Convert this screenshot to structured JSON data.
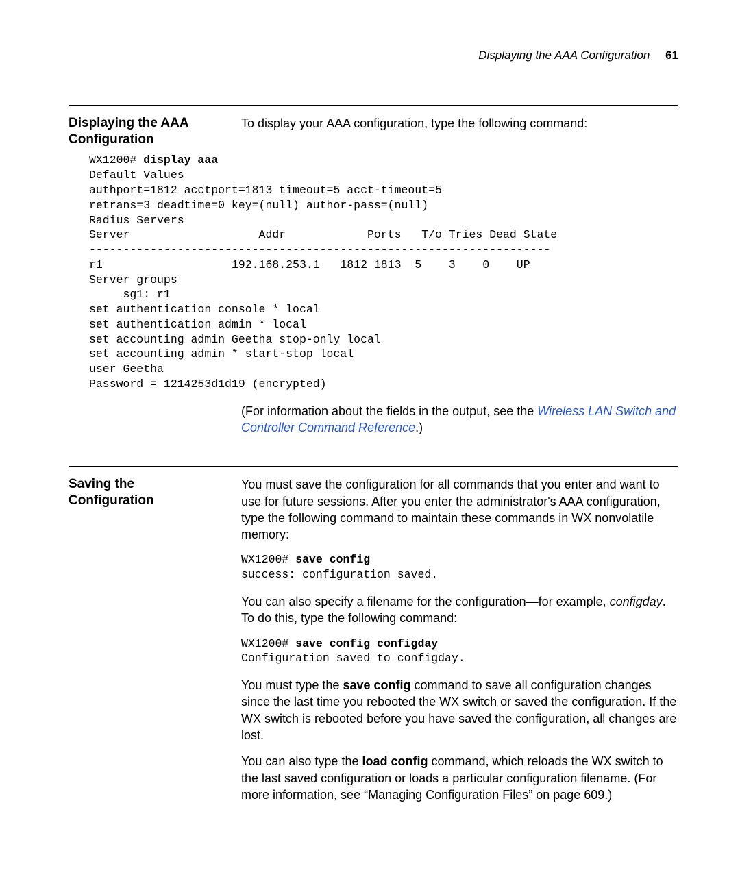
{
  "running_head": {
    "title": "Displaying the AAA Configuration",
    "page_number": "61"
  },
  "section1": {
    "heading": "Displaying the AAA Configuration",
    "intro": "To display your AAA configuration, type the following command:",
    "cli_prompt": "WX1200# ",
    "cli_cmd": "display aaa",
    "cli_output": "Default Values\nauthport=1812 acctport=1813 timeout=5 acct-timeout=5\nretrans=3 deadtime=0 key=(null) author-pass=(null)\nRadius Servers\nServer                   Addr            Ports   T/o Tries Dead State\n--------------------------------------------------------------------\nr1                   192.168.253.1   1812 1813  5    3    0    UP\nServer groups\n     sg1: r1\nset authentication console * local\nset authentication admin * local\nset accounting admin Geetha stop-only local\nset accounting admin * start-stop local\nuser Geetha\nPassword = 1214253d1d19 (encrypted)",
    "note_pre": "(For information about the fields in the output, see the ",
    "note_link": "Wireless LAN Switch and Controller Command Reference",
    "note_post": ".)"
  },
  "section2": {
    "heading": "Saving the Configuration",
    "para1": "You must save the configuration for all commands that you enter and want to use for future sessions. After you enter the administrator's AAA configuration, type the following command to maintain these commands in WX nonvolatile memory:",
    "cli1_prompt": "WX1200# ",
    "cli1_cmd": "save config",
    "cli1_out": "success: configuration saved.",
    "para2a": "You can also specify a filename for the configuration—for example, ",
    "para2b_italic": "configday",
    "para2c": ". To do this, type the following command:",
    "cli2_prompt": "WX1200# ",
    "cli2_cmd": "save config configday",
    "cli2_out": "Configuration saved to configday.",
    "para3a": "You must type the ",
    "para3b_bold": "save config",
    "para3c": " command to save all configuration changes since the last time you rebooted the WX switch or saved the configuration. If the WX switch is rebooted before you have saved the configuration, all changes are lost.",
    "para4a": "You can also type the ",
    "para4b_bold": "load config",
    "para4c": " command, which reloads the WX switch to the last saved configuration or loads a particular configuration filename. (For more information, see “Managing Configuration Files” on page 609.)"
  }
}
